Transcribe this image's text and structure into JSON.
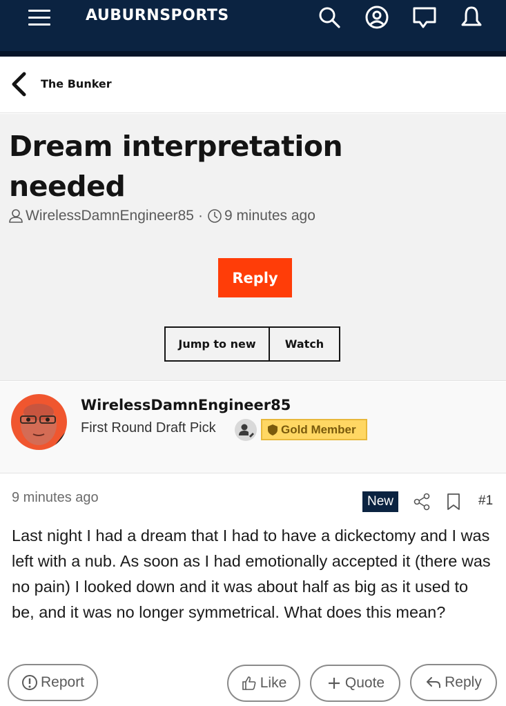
{
  "header": {
    "brand": "AUBURNSPORTS",
    "icons": [
      "menu-icon",
      "search-icon",
      "account-icon",
      "chat-icon",
      "bell-icon"
    ],
    "bg_color": "#0b2341"
  },
  "breadcrumb": {
    "label": "The Bunker"
  },
  "thread": {
    "title": "Dream interpretation needed",
    "author": "WirelessDamnEngineer85",
    "separator": "·",
    "time": "9 minutes ago",
    "reply_label": "Reply",
    "jump_label": "Jump to new",
    "watch_label": "Watch",
    "accent_color": "#ff3d08"
  },
  "author_block": {
    "username": "WirelessDamnEngineer85",
    "rank": "First Round Draft Pick",
    "badge": "Gold Member",
    "badge_color": "#ffd763"
  },
  "post": {
    "time": "9 minutes ago",
    "new_label": "New",
    "number": "#1",
    "body": "Last night I had a dream that I had to have a dickectomy and I was left with a nub. As soon as I had emotionally accepted it (there was no pain) I looked down and it was about half as big as it used to be, and it was no longer symmetrical. What does this mean?"
  },
  "actions": {
    "report": "Report",
    "like": "Like",
    "quote": "Quote",
    "reply": "Reply"
  }
}
